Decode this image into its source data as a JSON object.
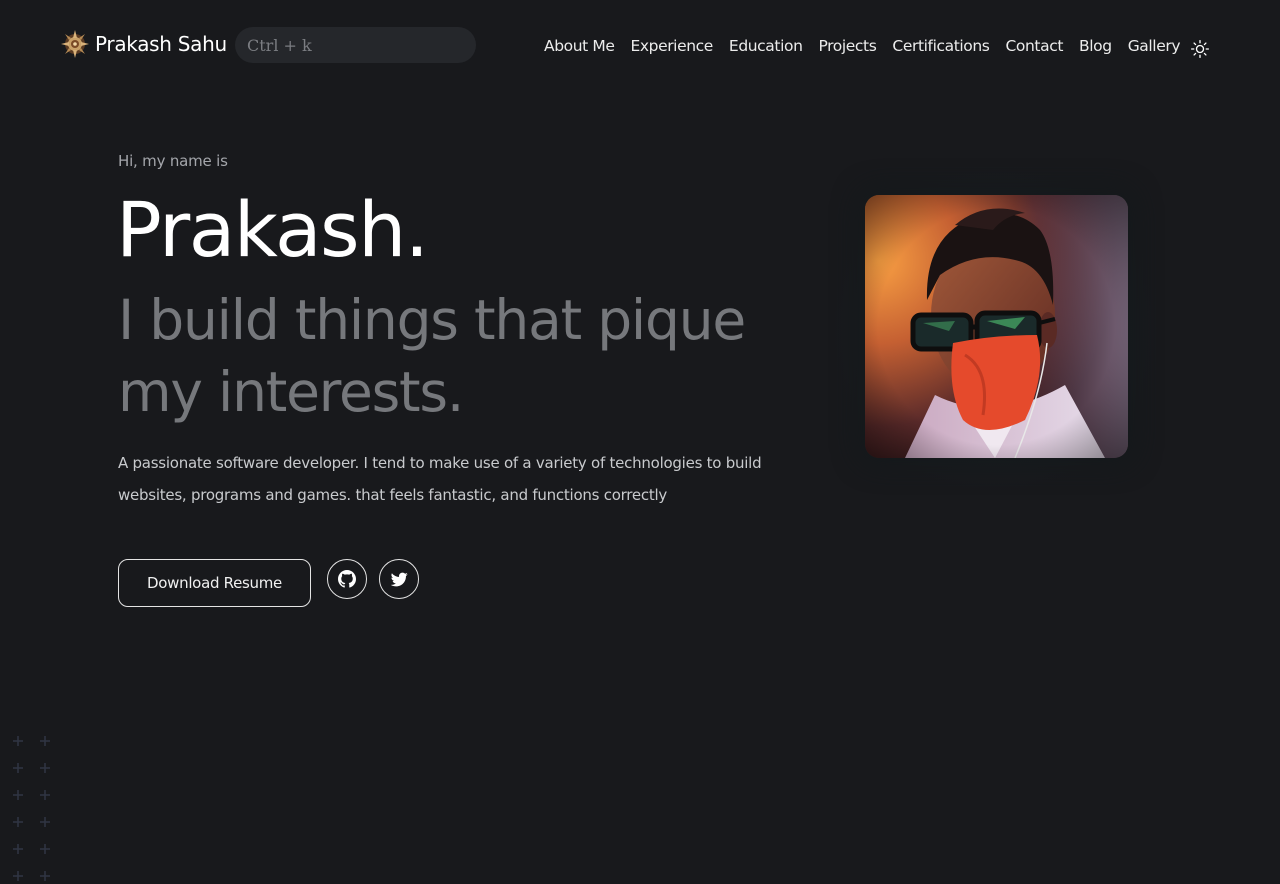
{
  "header": {
    "logo_text": "Prakash Sahu",
    "search_placeholder": "Ctrl + k",
    "nav": [
      {
        "label": "About Me"
      },
      {
        "label": "Experience"
      },
      {
        "label": "Education"
      },
      {
        "label": "Projects"
      },
      {
        "label": "Certifications"
      },
      {
        "label": "Contact"
      },
      {
        "label": "Blog"
      },
      {
        "label": "Gallery"
      }
    ],
    "theme_icon": "sun-icon"
  },
  "hero": {
    "greeting": "Hi, my name is",
    "name": "Prakash.",
    "tagline": "I build things that pique my interests.",
    "description": "A passionate software developer. I tend to make use of a variety of technologies to build websites, programs and games. that feels fantastic, and functions correctly",
    "resume_button": "Download Resume",
    "social_icons": [
      "github-icon",
      "twitter-icon"
    ],
    "portrait_icon": "profile-photo"
  },
  "colors": {
    "background": "#18191c",
    "name": "#ffffff",
    "tagline": "#76787c",
    "search_bg": "#25272b"
  }
}
